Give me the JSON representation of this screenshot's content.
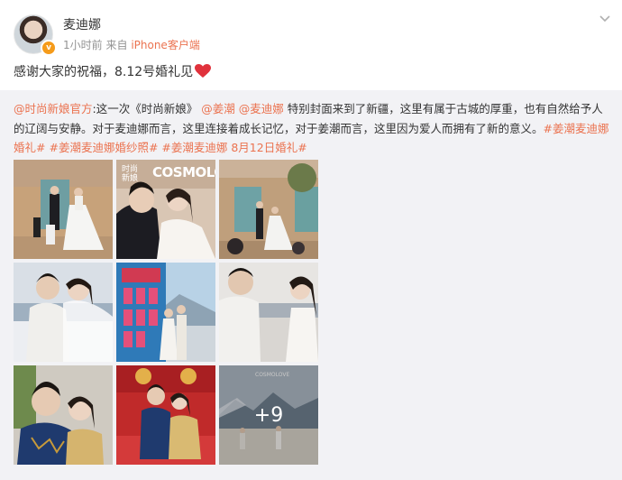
{
  "post": {
    "username": "麦迪娜",
    "time": "1小时前",
    "source_prefix": "来自",
    "source": "iPhone客户端",
    "text": "感谢大家的祝福，8.12号婚礼见",
    "heart_icon": "red-heart-emoji"
  },
  "repost": {
    "author": "@时尚新娘官方",
    "text_1": ":这一次《时尚新娘》",
    "mention_1": "@姜潮",
    "mention_2": "@麦迪娜",
    "text_2": " 特别封面来到了新疆，这里有属于古城的厚重，也有自然给予人的辽阔与安静。对于麦迪娜而言，这里连接着成长记忆，对于姜潮而言，这里因为爱人而拥有了新的意义。",
    "tag_1": "#姜潮麦迪娜婚礼#",
    "tag_2": "#姜潮麦迪娜婚纱照#",
    "tag_3": "#姜潮麦迪娜 8月12日婚礼#",
    "more_count": "+9",
    "magazine_title": "COSMOLOVE",
    "magazine_sub": "时尚\n新娘",
    "image_4_text": "COSMOLOVE"
  },
  "colors": {
    "link": "#eb7350",
    "repost_bg": "#f2f2f5",
    "meta": "#939393"
  }
}
